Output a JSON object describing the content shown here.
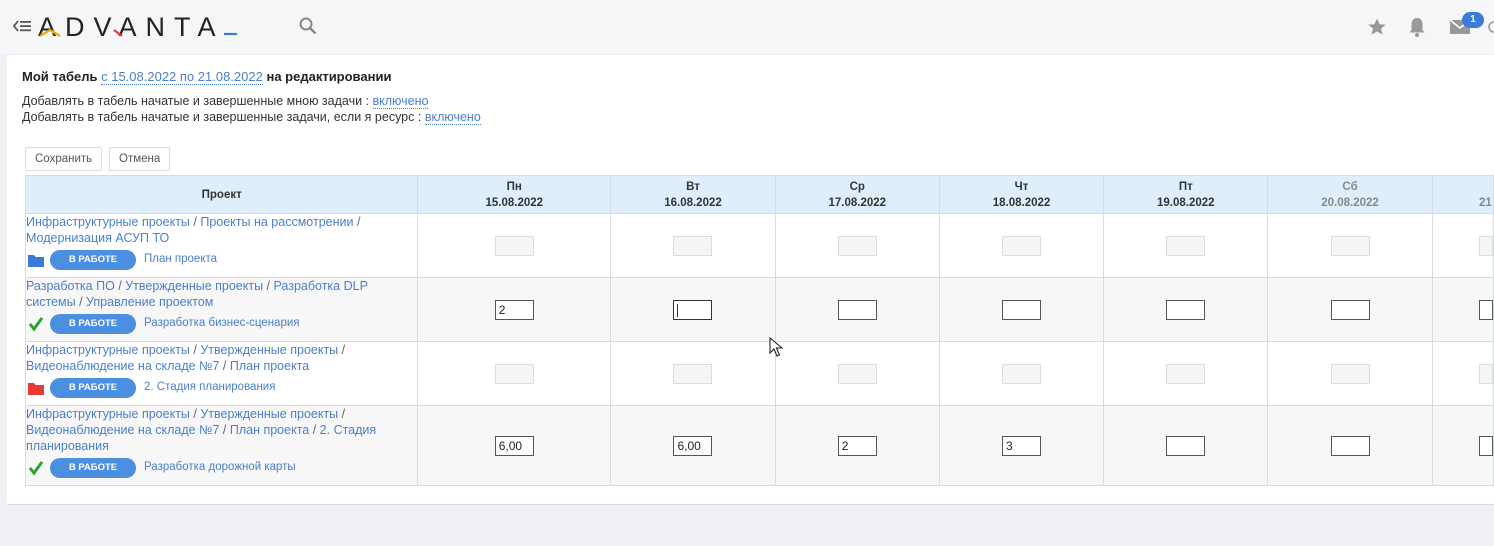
{
  "header": {
    "logo_text": "ADVANTA",
    "icons": [
      "menu-collapse-icon",
      "search-icon",
      "star-icon",
      "bell-icon",
      "mail-icon"
    ],
    "mail_badge": "1"
  },
  "title": {
    "prefix": "Мой табель",
    "period": "с 15.08.2022 по 21.08.2022",
    "suffix": "на редактировании"
  },
  "settings": [
    {
      "label": "Добавлять в табель начатые и завершенные мною задачи :",
      "value": "включено"
    },
    {
      "label": "Добавлять в табель начатые и завершенные задачи, если я ресурс :",
      "value": "включено"
    }
  ],
  "buttons": {
    "save": "Сохранить",
    "cancel": "Отмена"
  },
  "table": {
    "project_header": "Проект",
    "days": [
      {
        "day": "Пн",
        "date": "15.08.2022"
      },
      {
        "day": "Вт",
        "date": "16.08.2022"
      },
      {
        "day": "Ср",
        "date": "17.08.2022"
      },
      {
        "day": "Чт",
        "date": "18.08.2022"
      },
      {
        "day": "Пт",
        "date": "19.08.2022"
      },
      {
        "day": "Сб",
        "date": "20.08.2022"
      },
      {
        "day": "",
        "date": "21"
      }
    ],
    "rows": [
      {
        "path": [
          "Инфраструктурные проекты",
          "Проекты на рассмотрении",
          "Модернизация АСУП ТО"
        ],
        "icon": "folder-blue-icon",
        "status": "В РАБОТЕ",
        "task": "План проекта",
        "hours": [
          "",
          "",
          "",
          "",
          "",
          "",
          ""
        ],
        "editable": false
      },
      {
        "path": [
          "Разработка ПО",
          "Утвержденные проекты",
          "Разработка DLP системы",
          "Управление проектом"
        ],
        "icon": "check-icon",
        "status": "В РАБОТЕ",
        "task": "Разработка бизнес-сценария",
        "hours": [
          "2",
          "",
          "",
          "",
          "",
          "",
          ""
        ],
        "editable": true
      },
      {
        "path": [
          "Инфраструктурные проекты",
          "Утвержденные проекты",
          "Видеонаблюдение на складе №7",
          "План проекта"
        ],
        "icon": "folder-red-icon",
        "status": "В РАБОТЕ",
        "task": "2. Стадия планирования",
        "hours": [
          "",
          "",
          "",
          "",
          "",
          "",
          ""
        ],
        "editable": false
      },
      {
        "path": [
          "Инфраструктурные проекты",
          "Утвержденные проекты",
          "Видеонаблюдение на складе №7",
          "План проекта",
          "2. Стадия планирования"
        ],
        "icon": "check-icon",
        "status": "В РАБОТЕ",
        "task": "Разработка дорожной карты",
        "hours": [
          "6,00",
          "6,00",
          "2",
          "3",
          "",
          "",
          ""
        ],
        "editable": true
      }
    ]
  },
  "colors": {
    "link": "#4a7fc9",
    "header_bg": "#dfeefc",
    "status_badge": "#4a8fe0",
    "folder_blue": "#3a7bd5",
    "folder_red": "#e53935",
    "check_green": "#2ea12e"
  }
}
